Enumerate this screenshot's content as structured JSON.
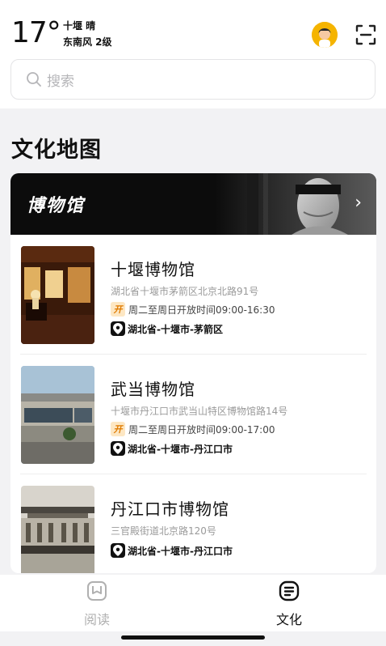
{
  "status": {
    "temperature": "17°",
    "city_weather": "十堰 晴",
    "wind": "东南风 2级"
  },
  "search": {
    "placeholder": "搜索"
  },
  "section": {
    "title": "文化地图"
  },
  "banner": {
    "title": "博物馆",
    "chevron": "›"
  },
  "museums": [
    {
      "name": "十堰博物馆",
      "address": "湖北省十堰市茅箭区北京北路91号",
      "hours_badge": "开",
      "hours": "周二至周日开放时间09:00-16:30",
      "region": "湖北省-十堰市-茅箭区"
    },
    {
      "name": "武当博物馆",
      "address": "十堰市丹江口市武当山特区博物馆路14号",
      "hours_badge": "开",
      "hours": "周二至周日开放时间09:00-17:00",
      "region": "湖北省-十堰市-丹江口市"
    },
    {
      "name": "丹江口市博物馆",
      "address": "三官殿街道北京路120号",
      "region": "湖北省-十堰市-丹江口市"
    }
  ],
  "tabs": [
    {
      "label": "阅读",
      "icon": "book-icon",
      "active": false
    },
    {
      "label": "文化",
      "icon": "culture-list-icon",
      "active": true
    }
  ],
  "colors": {
    "accent_orange": "#e07b00",
    "badge_bg": "#fde7c3",
    "inactive_tab": "#b0b0b0",
    "active_tab": "#111111"
  }
}
